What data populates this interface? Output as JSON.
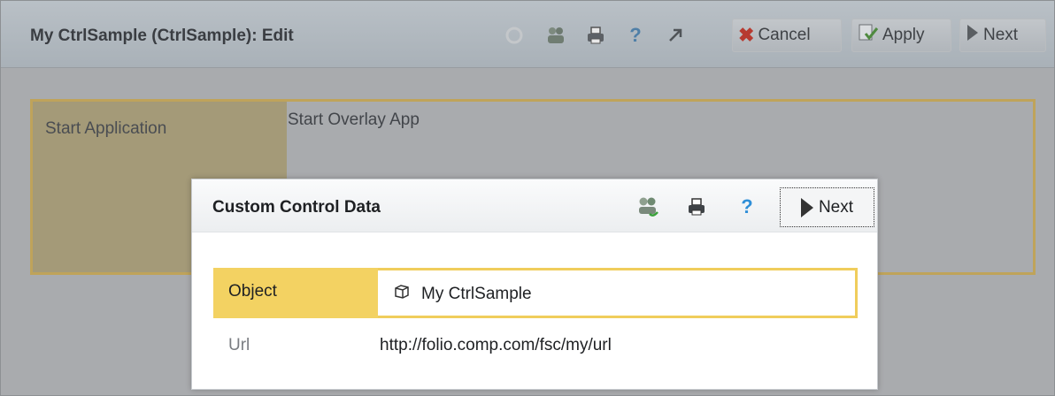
{
  "window": {
    "title": "My CtrlSample (CtrlSample): Edit",
    "toolbar": {
      "cancel_label": "Cancel",
      "apply_label": "Apply",
      "next_label": "Next"
    }
  },
  "main": {
    "field_label": "Start Application",
    "field_value": "Start Overlay App"
  },
  "dialog": {
    "title": "Custom Control Data",
    "next_label": "Next",
    "rows": [
      {
        "label": "Object",
        "value": "My CtrlSample",
        "icon": "cube-icon"
      },
      {
        "label": "Url",
        "value": "http://folio.comp.com/fsc/my/url"
      }
    ]
  },
  "colors": {
    "highlight_yellow": "#f3d262",
    "dim_overlay": "#a9abae",
    "cancel_red": "#d9362b",
    "help_blue": "#2f8fd8"
  }
}
